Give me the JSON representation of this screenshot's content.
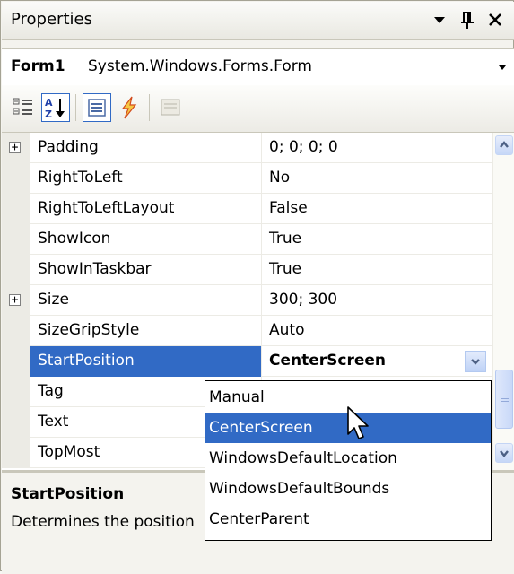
{
  "panel": {
    "title": "Properties",
    "object_name": "Form1",
    "object_type": "System.Windows.Forms.Form"
  },
  "titlebar_buttons": [
    {
      "name": "window-position-menu",
      "glyph": "▾"
    },
    {
      "name": "auto-hide-pin",
      "glyph": "⊥"
    },
    {
      "name": "close",
      "glyph": "✕"
    }
  ],
  "toolbar": [
    {
      "name": "categorized-button",
      "icon": "categorized-icon",
      "pressed": false
    },
    {
      "name": "alphabetical-button",
      "icon": "sort-az-icon",
      "pressed": true
    },
    {
      "name": "properties-button",
      "icon": "properties-icon",
      "pressed": true
    },
    {
      "name": "events-button",
      "icon": "lightning-icon",
      "pressed": false
    },
    {
      "name": "property-pages-button",
      "icon": "property-pages-icon",
      "pressed": false,
      "disabled": true
    }
  ],
  "properties": [
    {
      "name": "Padding",
      "value": "0; 0; 0; 0",
      "expandable": true
    },
    {
      "name": "RightToLeft",
      "value": "No",
      "expandable": false
    },
    {
      "name": "RightToLeftLayout",
      "value": "False",
      "expandable": false
    },
    {
      "name": "ShowIcon",
      "value": "True",
      "expandable": false
    },
    {
      "name": "ShowInTaskbar",
      "value": "True",
      "expandable": false
    },
    {
      "name": "Size",
      "value": "300; 300",
      "expandable": true
    },
    {
      "name": "SizeGripStyle",
      "value": "Auto",
      "expandable": false
    },
    {
      "name": "StartPosition",
      "value": "CenterScreen",
      "expandable": false,
      "selected": true
    },
    {
      "name": "Tag",
      "value": "",
      "expandable": false
    },
    {
      "name": "Text",
      "value": "",
      "expandable": false
    },
    {
      "name": "TopMost",
      "value": "",
      "expandable": false
    }
  ],
  "dropdown": {
    "options": [
      "Manual",
      "CenterScreen",
      "WindowsDefaultLocation",
      "WindowsDefaultBounds",
      "CenterParent"
    ],
    "highlighted_index": 1
  },
  "description": {
    "title": "StartPosition",
    "text": "Determines the position of a form when it first appears."
  },
  "colors": {
    "selection": "#316ac5",
    "panel_bg": "#f4f3ee",
    "border": "#a5a394"
  }
}
